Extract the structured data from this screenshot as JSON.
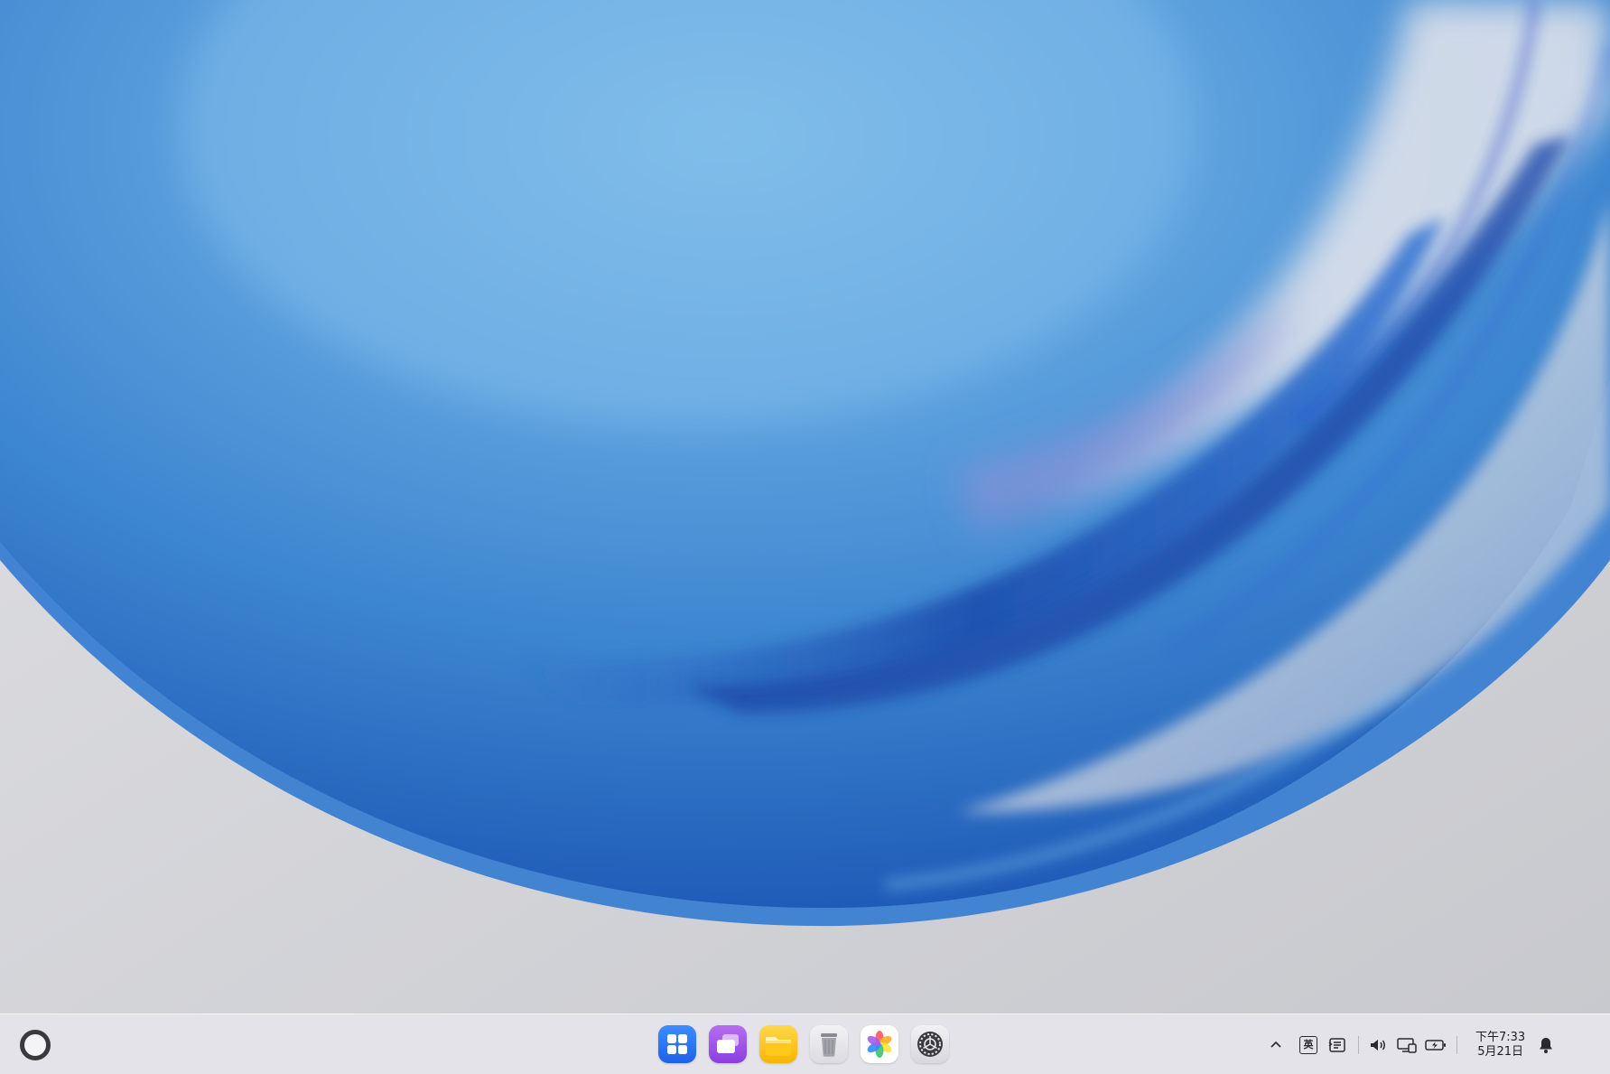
{
  "desktop": {
    "wallpaper": {
      "description_colors": [
        "#2f7ccc",
        "#6aaee6",
        "#1f4fb3",
        "#d8d8dc"
      ]
    }
  },
  "taskbar": {
    "launcher": {
      "icon": "launcher-ring-icon"
    },
    "dock": {
      "items": [
        {
          "name": "app-center",
          "icon": "grid-apps-icon"
        },
        {
          "name": "multitask-view",
          "icon": "windows-stack-icon"
        },
        {
          "name": "file-manager",
          "icon": "folder-icon"
        },
        {
          "name": "trash",
          "icon": "trash-icon"
        },
        {
          "name": "photos",
          "icon": "pinwheel-photos-icon"
        },
        {
          "name": "settings",
          "icon": "settings-gear-icon"
        }
      ]
    },
    "tray": {
      "expand": {
        "icon": "chevron-up-icon"
      },
      "ime_label": "英",
      "clipboard": {
        "icon": "clipboard-icon"
      },
      "volume": {
        "icon": "volume-icon"
      },
      "display": {
        "icon": "display-icon"
      },
      "battery": {
        "icon": "battery-icon"
      },
      "clock": {
        "time": "下午7:33",
        "date": "5月21日"
      },
      "notifications": {
        "icon": "bell-icon"
      }
    }
  }
}
